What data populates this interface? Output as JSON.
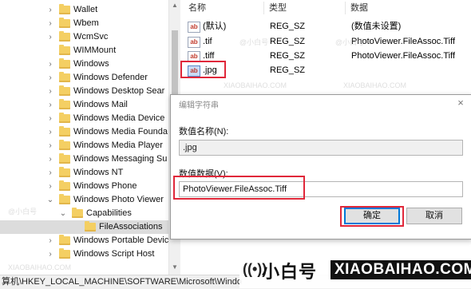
{
  "tree": {
    "items": [
      {
        "label": "Wallet",
        "chev": "›",
        "sel": false
      },
      {
        "label": "Wbem",
        "chev": "›",
        "sel": false
      },
      {
        "label": "WcmSvc",
        "chev": "›",
        "sel": false
      },
      {
        "label": "WIMMount",
        "chev": "",
        "sel": false
      },
      {
        "label": "Windows",
        "chev": "›",
        "sel": false
      },
      {
        "label": "Windows Defender",
        "chev": "›",
        "sel": false
      },
      {
        "label": "Windows Desktop Sear",
        "chev": "›",
        "sel": false
      },
      {
        "label": "Windows Mail",
        "chev": "›",
        "sel": false
      },
      {
        "label": "Windows Media Device",
        "chev": "›",
        "sel": false
      },
      {
        "label": "Windows Media Founda",
        "chev": "›",
        "sel": false
      },
      {
        "label": "Windows Media Player",
        "chev": "›",
        "sel": false
      },
      {
        "label": "Windows Messaging Su",
        "chev": "›",
        "sel": false
      },
      {
        "label": "Windows NT",
        "chev": "›",
        "sel": false
      },
      {
        "label": "Windows Phone",
        "chev": "›",
        "sel": false
      },
      {
        "label": "Windows Photo Viewer",
        "chev": "⌄",
        "sel": false
      },
      {
        "label": "Capabilities",
        "chev": "⌄",
        "sel": false
      },
      {
        "label": "FileAssociations",
        "chev": "",
        "sel": true
      },
      {
        "label": "Windows Portable Devic",
        "chev": "›",
        "sel": false
      },
      {
        "label": "Windows Script Host",
        "chev": "›",
        "sel": false
      }
    ]
  },
  "list": {
    "headers": {
      "name": "名称",
      "type": "类型",
      "data": "数据"
    },
    "rows": [
      {
        "name": "(默认)",
        "type": "REG_SZ",
        "data": "(数值未设置)"
      },
      {
        "name": ".tif",
        "type": "REG_SZ",
        "data": "PhotoViewer.FileAssoc.Tiff"
      },
      {
        "name": ".tiff",
        "type": "REG_SZ",
        "data": "PhotoViewer.FileAssoc.Tiff"
      },
      {
        "name": ".jpg",
        "type": "REG_SZ",
        "data": ""
      }
    ]
  },
  "dialog": {
    "title": "编辑字符串",
    "close": "×",
    "name_label": "数值名称(N):",
    "name_value": ".jpg",
    "value_label": "数值数据(V):",
    "value_value": "PhotoViewer.FileAssoc.Tiff",
    "ok": "确定",
    "cancel": "取消"
  },
  "status": {
    "path": "算机\\HKEY_LOCAL_MACHINE\\SOFTWARE\\Microsoft\\Windo"
  },
  "watermark": {
    "cn": "@小白号",
    "en": "XIAOBAIHAO.COM"
  },
  "brand": {
    "cn": "小白号",
    "en": "XIAOBAIHAO.COM"
  },
  "colors": {
    "highlight": "#e0283a",
    "folder": "#f4cf63",
    "accent": "#0078d7"
  },
  "icons": {
    "value_icon": "ab-string-icon",
    "folder_icon": "folder-icon",
    "brand_icon": "radio-wave-icon"
  }
}
